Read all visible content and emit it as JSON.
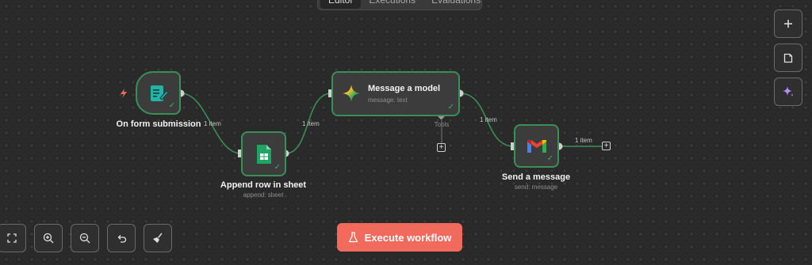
{
  "tabs": [
    {
      "label": "Editor",
      "active": true
    },
    {
      "label": "Executions",
      "active": false
    },
    {
      "label": "Evaluations",
      "active": false
    }
  ],
  "nodes": {
    "trigger": {
      "label": "On form submission"
    },
    "sheet": {
      "label": "Append row in sheet",
      "sub": "append: sheet"
    },
    "model": {
      "label": "Message a model",
      "sub": "message: text",
      "tools_label": "Tools"
    },
    "gmail": {
      "label": "Send a message",
      "sub": "send: message"
    }
  },
  "connections": {
    "trigger_to_sheet": "1 item",
    "sheet_to_model": "1 item",
    "model_to_gmail": "1 item",
    "gmail_out": "1 item"
  },
  "toolbar": {
    "execute_label": "Execute workflow"
  },
  "colors": {
    "canvas": "#2a2a2a",
    "node_border": "#3a8f58",
    "execute": "#f26a5c",
    "sparkle": "#b98cff"
  }
}
